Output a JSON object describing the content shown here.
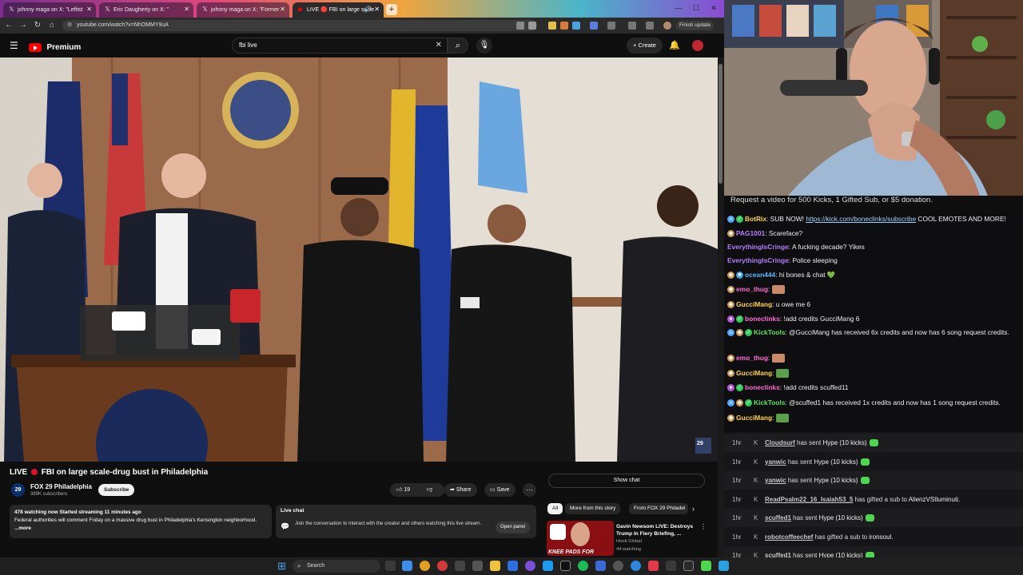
{
  "browser": {
    "tabs": [
      {
        "label": "johnny maga on X: \"Leftist",
        "active": false
      },
      {
        "label": "Eric Daugherty on X: \"",
        "active": false
      },
      {
        "label": "johnny maga on X: \"Former",
        "active": false
      },
      {
        "label": "LIVE 🔴 FBI on large scale",
        "active": true
      }
    ],
    "url": "youtube.com/watch?v=NhOMMY9uA",
    "finish_update": "Finish update"
  },
  "youtube": {
    "logo_text": "Premium",
    "search_value": "fbi live",
    "create_label": "Create",
    "video_title_prefix": "LIVE",
    "video_title": "FBI on large scale-drug bust in Philadelphia",
    "channel_name": "FOX 29 Philadelphia",
    "channel_avatar": "29",
    "channel_subs": "389K subscribers",
    "subscribe_label": "Subscribe",
    "likes": "19",
    "share_label": "Share",
    "save_label": "Save",
    "description_meta": "478 watching now  Started streaming 11 minutes ago",
    "description_text": "Federal authorities will comment Friday on a massive drug bust in Philadelphia's Kensington neighborhood.",
    "description_more": "...more",
    "live_chat_title": "Live chat",
    "live_chat_text": "Join the conversation to interact with the creator and others watching this live stream.",
    "open_panel_label": "Open panel",
    "show_chat_label": "Show chat",
    "chips": [
      "All",
      "More from this story",
      "From FOX 29 Philadel"
    ],
    "recommended": {
      "thumb_text": "KNEE PADS FOR",
      "title": "Gavin Newsom LIVE: Destroys Trump In Fiery Briefing, ...",
      "channel": "Hook Global",
      "views": "44 watching"
    },
    "video_watermark": "29"
  },
  "stream": {
    "request_line": "Request a video for 500 Kicks, 1 Gifted Sub, or $5 donation.",
    "chat": [
      {
        "user": "BotRix",
        "color": "#ffd54a",
        "text_before": ": SUB NOW! ",
        "link": "https://kick.com/boneclinks/subscribe",
        "text_after": " COOL EMOTES AND MORE!",
        "badges": [
          "sword",
          "check"
        ]
      },
      {
        "user": "PAG1001",
        "color": "#b77dff",
        "text_before": ": Scareface?",
        "badges": [
          "bag"
        ]
      },
      {
        "user": "EverythingIsCringe",
        "color": "#b77dff",
        "text_before": ": A fucking decade? Yikes",
        "badges": []
      },
      {
        "user": "EverythingIsCringe",
        "color": "#b77dff",
        "text_before": ": Police sleeping",
        "badges": []
      },
      {
        "user": "ocean444",
        "color": "#5ab8ff",
        "text_before": ": hi bones & chat 💚",
        "badges": [
          "bag",
          "box"
        ]
      },
      {
        "user": "emo_thug",
        "color": "#ff6bd6",
        "text_before": ": ",
        "emote": true,
        "badges": [
          "bag"
        ]
      },
      {
        "user": "GucciMang",
        "color": "#ffd54a",
        "text_before": ": u owe me 6",
        "badges": [
          "bag"
        ]
      },
      {
        "user": "boneclinks",
        "color": "#ff6bd6",
        "text_before": ": !add credits GucciMang 6",
        "badges": [
          "mic",
          "check"
        ]
      },
      {
        "user": "KickTools",
        "color": "#5fe05f",
        "text_before": ": @GucciMang has received 6x credits and now has 6 song request credits.",
        "badges": [
          "sword",
          "bag",
          "check"
        ]
      },
      {
        "user": "emo_thug",
        "color": "#ff6bd6",
        "text_before": ": ",
        "emote": true,
        "badges": [
          "bag"
        ]
      },
      {
        "user": "GucciMang",
        "color": "#ffd54a",
        "text_before": ": ",
        "emote": true,
        "badges": [
          "bag"
        ]
      },
      {
        "user": "boneclinks",
        "color": "#ff6bd6",
        "text_before": ": !add credits scuffed11",
        "badges": [
          "mic",
          "check"
        ]
      },
      {
        "user": "KickTools",
        "color": "#5fe05f",
        "text_before": ": @scuffed1 has received 1x credits and now has 1 song request credits.",
        "badges": [
          "sword",
          "bag",
          "check"
        ]
      },
      {
        "user": "GucciMang",
        "color": "#ffd54a",
        "text_before": ": ",
        "emote": true,
        "badges": [
          "bag"
        ]
      }
    ],
    "events": [
      {
        "time": "1hr",
        "user": "Cloudsurf",
        "text": " has sent ",
        "highlight": "Hype (10 kicks)",
        "hype": true
      },
      {
        "time": "1hr",
        "user": "yanwic",
        "text": " has sent ",
        "highlight": "Hype (10 kicks)",
        "hype": true
      },
      {
        "time": "1hr",
        "user": "yanwic",
        "text": " has sent ",
        "highlight": "Hype (10 kicks)",
        "hype": true
      },
      {
        "time": "1hr",
        "user": "ReadPsalm22_16_Isaiah53_5",
        "text": " has gifted a sub to ",
        "highlight": "AlienzVSIluminuti.",
        "hype": false
      },
      {
        "time": "1hr",
        "user": "scuffed1",
        "text": " has sent ",
        "highlight": "Hype (10 kicks)",
        "hype": true
      },
      {
        "time": "1hr",
        "user": "robotcoffeechef",
        "text": " has gifted a sub to ",
        "highlight": "ironsoul.",
        "hype": false
      },
      {
        "time": "1hr",
        "user": "scuffed1",
        "text": " has sent ",
        "highlight": "Hype (10 kicks)",
        "hype": true
      }
    ]
  },
  "taskbar": {
    "search_label": "Search"
  },
  "colors": {
    "youtube_red": "#ff0000",
    "live_red": "#e0112b",
    "kick_green": "#4fd64f"
  }
}
